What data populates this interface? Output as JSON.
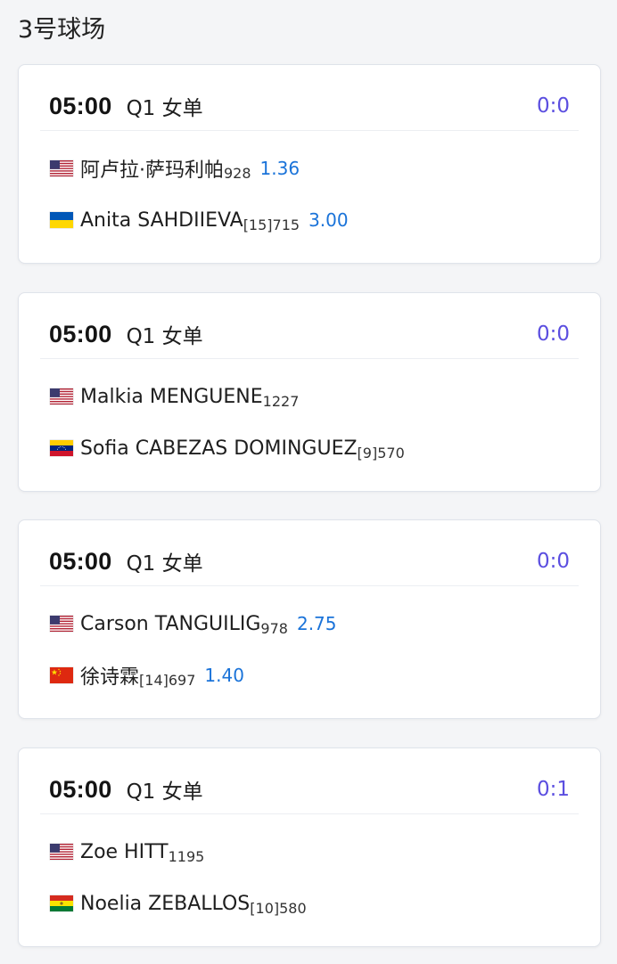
{
  "court": {
    "title": "3号球场"
  },
  "matches": [
    {
      "time": "05:00",
      "round": "Q1 女单",
      "score": "0:0",
      "players": [
        {
          "flag": "us-flag",
          "name": "阿卢拉·萨玛利帕",
          "rank": "928",
          "odds": "1.36"
        },
        {
          "flag": "ua-flag",
          "name": "Anita SAHDIIEVA",
          "rank": "[15]715",
          "odds": "3.00"
        }
      ]
    },
    {
      "time": "05:00",
      "round": "Q1 女单",
      "score": "0:0",
      "players": [
        {
          "flag": "us-flag",
          "name": "Malkia MENGUENE",
          "rank": "1227",
          "odds": ""
        },
        {
          "flag": "ve-flag",
          "name": "Sofia CABEZAS DOMINGUEZ",
          "rank": "[9]570",
          "odds": ""
        }
      ]
    },
    {
      "time": "05:00",
      "round": "Q1 女单",
      "score": "0:0",
      "players": [
        {
          "flag": "us-flag",
          "name": "Carson TANGUILIG",
          "rank": "978",
          "odds": "2.75"
        },
        {
          "flag": "cn-flag",
          "name": "徐诗霖",
          "rank": "[14]697",
          "odds": "1.40"
        }
      ]
    },
    {
      "time": "05:00",
      "round": "Q1 女单",
      "score": "0:1",
      "players": [
        {
          "flag": "us-flag",
          "name": "Zoe HITT",
          "rank": "1195",
          "odds": ""
        },
        {
          "flag": "bo-flag",
          "name": "Noelia ZEBALLOS",
          "rank": "[10]580",
          "odds": ""
        }
      ]
    }
  ],
  "colors": {
    "score": "#5b4ee0",
    "odds": "#1a73d9",
    "card_border": "#dfe3ea",
    "background": "#f4f5f7"
  }
}
